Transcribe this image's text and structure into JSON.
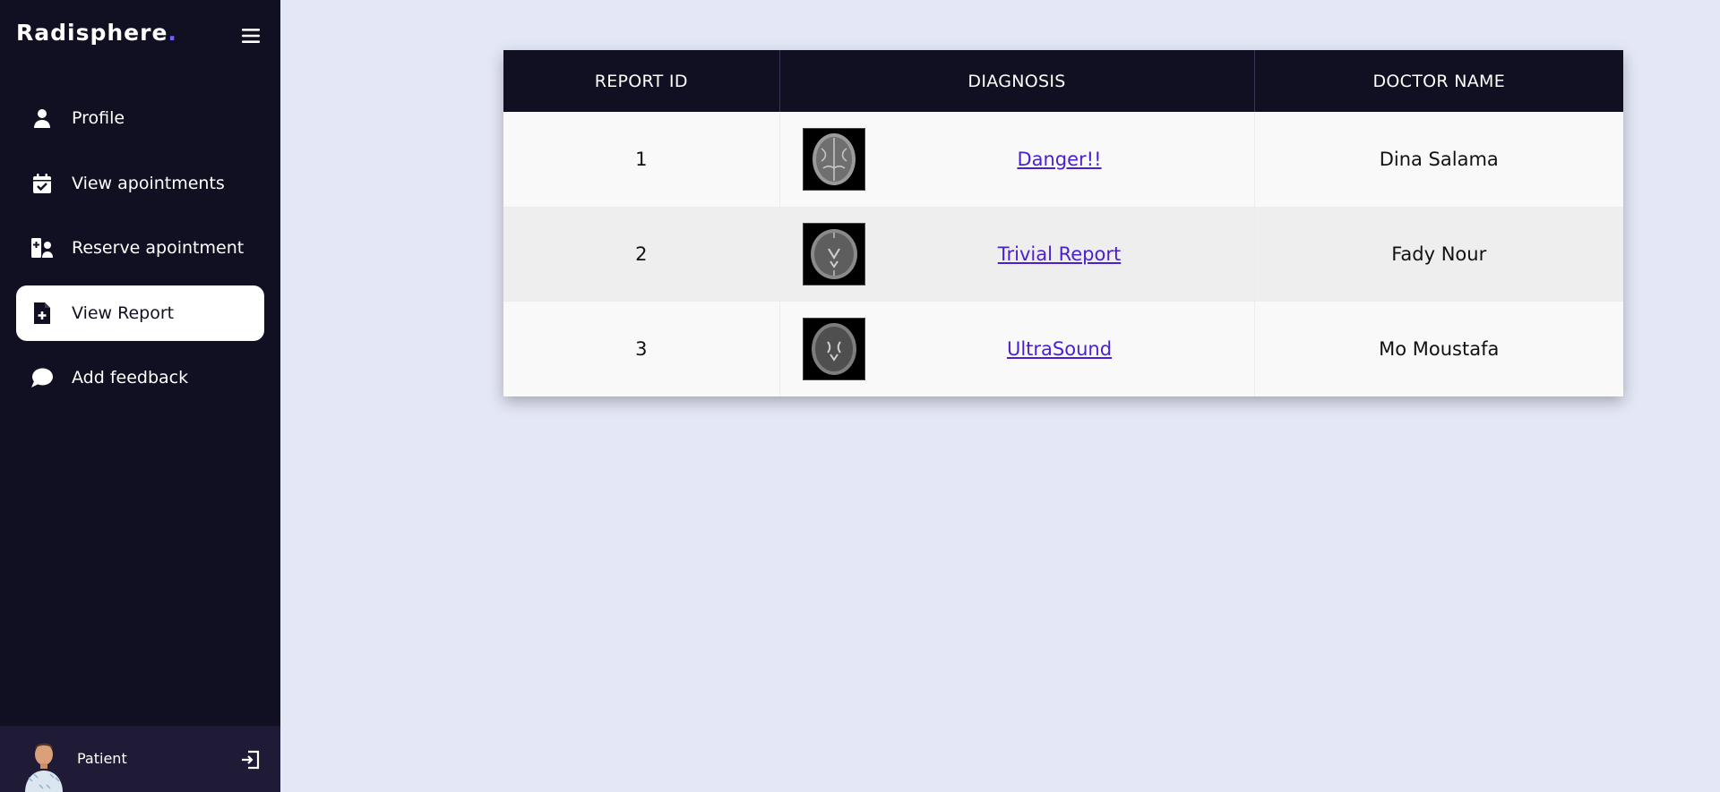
{
  "brand": {
    "name": "Radisphere",
    "dot": "."
  },
  "sidebar": {
    "menu_icon": "hamburger-menu-icon",
    "items": [
      {
        "label": "Profile",
        "icon": "user-icon",
        "active": false
      },
      {
        "label": "View apointments",
        "icon": "calendar-check-icon",
        "active": false
      },
      {
        "label": "Reserve apointment",
        "icon": "doctor-plus-icon",
        "active": false
      },
      {
        "label": "View Report",
        "icon": "medical-file-icon",
        "active": true
      },
      {
        "label": "Add feedback",
        "icon": "chat-bubble-icon",
        "active": false
      }
    ]
  },
  "user": {
    "role": "Patient",
    "avatar_icon": "patient-avatar",
    "logout_icon": "logout-icon"
  },
  "table": {
    "headers": [
      "REPORT ID",
      "DIAGNOSIS",
      "DOCTOR NAME"
    ],
    "rows": [
      {
        "id": "1",
        "diagnosis": "Danger!!",
        "doctor": "Dina Salama"
      },
      {
        "id": "2",
        "diagnosis": "Trivial Report",
        "doctor": "Fady Nour"
      },
      {
        "id": "3",
        "diagnosis": "UltraSound",
        "doctor": "Mo Moustafa"
      }
    ]
  },
  "colors": {
    "sidebar_bg": "#110f22",
    "page_bg": "#e4e7f6",
    "accent_dot": "#6c63ff",
    "link": "#4a1fd1"
  }
}
